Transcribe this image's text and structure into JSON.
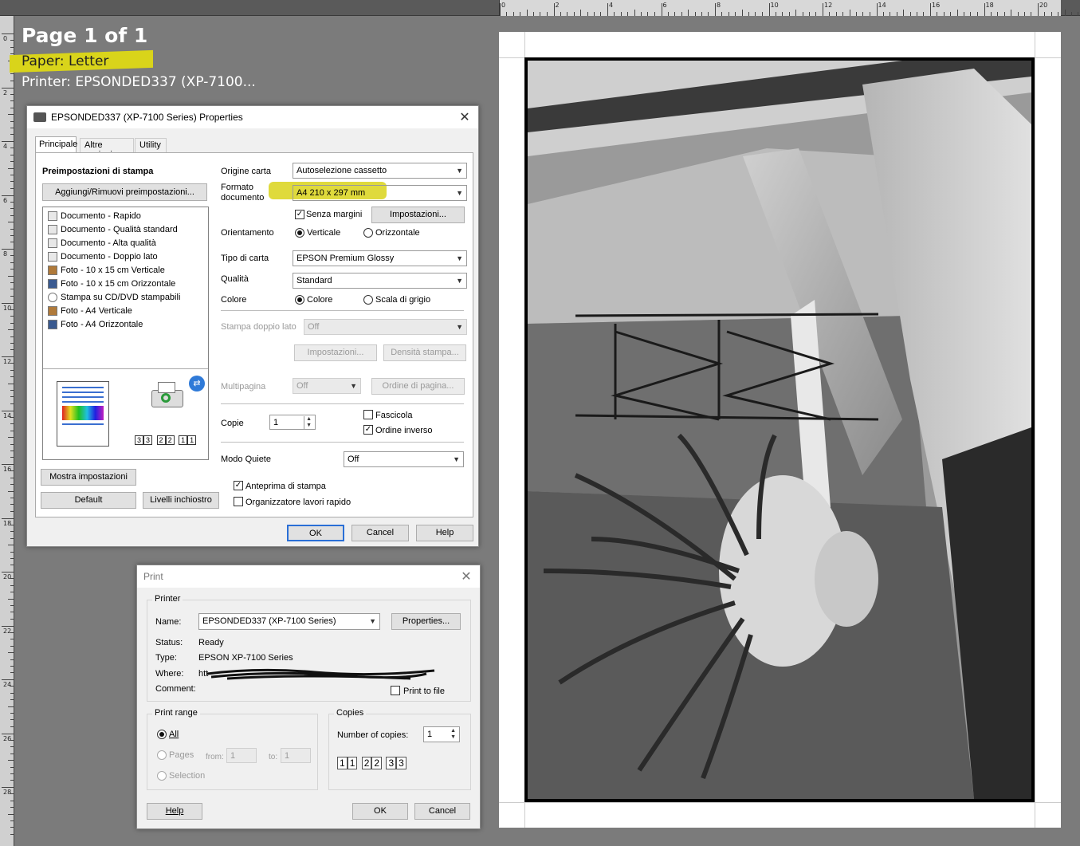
{
  "ruler": {
    "top_marks": [
      "0",
      "2",
      "4",
      "6",
      "8",
      "10",
      "12",
      "14",
      "16",
      "18",
      "20"
    ],
    "left_marks": [
      "0",
      "2",
      "4",
      "6",
      "8",
      "10",
      "12",
      "14",
      "16",
      "18",
      "20",
      "22",
      "24",
      "26",
      "28"
    ]
  },
  "info": {
    "page": "Page 1 of 1",
    "paper": "Paper:  Letter",
    "printer": "Printer:  EPSONDED337 (XP-7100..."
  },
  "props": {
    "title": "EPSONDED337 (XP-7100 Series) Properties",
    "tabs": [
      "Principale",
      "Altre opzioni",
      "Utility"
    ],
    "presets_heading": "Preimpostazioni di stampa",
    "add_remove": "Aggiungi/Rimuovi preimpostazioni...",
    "presets": [
      "Documento - Rapido",
      "Documento - Qualità standard",
      "Documento - Alta qualità",
      "Documento - Doppio lato",
      "Foto - 10 x 15 cm Verticale",
      "Foto - 10 x 15 cm Orizzontale",
      "Stampa su CD/DVD stampabili",
      "Foto - A4 Verticale",
      "Foto - A4 Orizzontale"
    ],
    "show_settings": "Mostra impostazioni",
    "default": "Default",
    "ink_levels": "Livelli inchiostro",
    "paper_source_label": "Origine carta",
    "paper_source": "Autoselezione cassetto",
    "doc_size_label": "Formato documento",
    "doc_size": "A4 210 x 297 mm",
    "borderless": "Senza margini",
    "settings_btn": "Impostazioni...",
    "orientation_label": "Orientamento",
    "portrait": "Verticale",
    "landscape": "Orizzontale",
    "paper_type_label": "Tipo di carta",
    "paper_type": "EPSON Premium Glossy",
    "quality_label": "Qualità",
    "quality": "Standard",
    "color_label": "Colore",
    "color": "Colore",
    "grayscale": "Scala di grigio",
    "duplex_label": "Stampa doppio lato",
    "duplex": "Off",
    "duplex_settings": "Impostazioni...",
    "print_density": "Densità stampa...",
    "multipage_label": "Multipagina",
    "multipage": "Off",
    "page_order": "Ordine di pagina...",
    "copies_label": "Copie",
    "copies": "1",
    "collate": "Fascicola",
    "reverse": "Ordine inverso",
    "quiet_label": "Modo Quiete",
    "quiet": "Off",
    "preview": "Anteprima di stampa",
    "job_arranger": "Organizzatore lavori rapido",
    "ok": "OK",
    "cancel": "Cancel",
    "help": "Help",
    "collate_icons": [
      "3",
      "3",
      "2",
      "2",
      "1",
      "1"
    ]
  },
  "print": {
    "title": "Print",
    "printer_group": "Printer",
    "name_label": "Name:",
    "name": "EPSONDED337 (XP-7100 Series)",
    "properties": "Properties...",
    "status_label": "Status:",
    "status": "Ready",
    "type_label": "Type:",
    "type": "EPSON XP-7100 Series",
    "where_label": "Where:",
    "where": "htt",
    "comment_label": "Comment:",
    "print_to_file": "Print to file",
    "range_group": "Print range",
    "all": "All",
    "pages": "Pages",
    "from_label": "from:",
    "from": "1",
    "to_label": "to:",
    "to": "1",
    "selection": "Selection",
    "copies_group": "Copies",
    "num_copies_label": "Number of copies:",
    "num_copies": "1",
    "collate_icons": [
      "1",
      "1",
      "2",
      "2",
      "3",
      "3"
    ],
    "help": "Help",
    "ok": "OK",
    "cancel": "Cancel"
  }
}
